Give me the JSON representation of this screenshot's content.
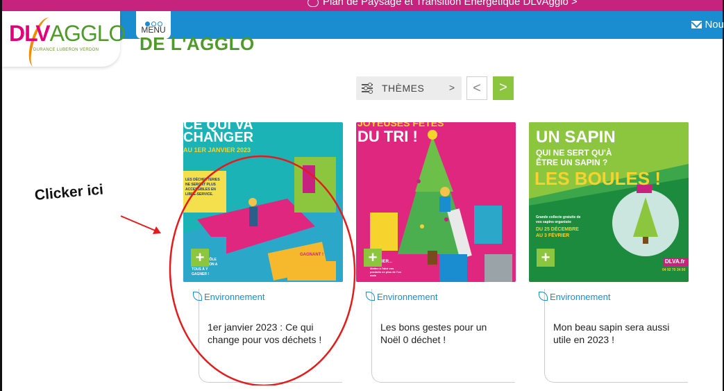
{
  "topbar": {
    "promo_text": "Plan de Paysage et Transition Energétique DLVAgglo >"
  },
  "header": {
    "logo": {
      "name": "DLVAGGLO",
      "dl": "DLV",
      "agglo": "AGGLO",
      "subtitle": "DURANCE LUBERON VERDON"
    },
    "menu_label": "MENU",
    "newsletter_label": "Nou",
    "section_title": "DE L'AGGLO"
  },
  "filters": {
    "themes_label": "THÈMES",
    "themes_chevron": ">",
    "prev": "<",
    "next": ">"
  },
  "cards": [
    {
      "tag": "Environnement",
      "title": "1er janvier 2023 : Ce qui change pour vos déchets !",
      "plus": "+",
      "art": {
        "headline1": "CE QUI VA",
        "headline2": "CHANGER",
        "headline3": "AU 1ER JANVIER 2023",
        "note1": "LES DÉCHETTERIES NE SERONT PLUS ACCESSIBLES EN LIBRE-SERVICE.",
        "note2": "LE CONTRÔLE D'ACCÈS, ON A TOUS À Y GAGNER !",
        "ticket": "GAGNANT !"
      },
      "bg": "#1bb3b5"
    },
    {
      "tag": "Environnement",
      "title": "Les bons gestes pour un Noël 0 déchet !",
      "plus": "+",
      "art": {
        "headline1": "JOYEUSES FÊTES",
        "headline2": "DU TRI !",
        "note1": "...XTRIER...",
        "note2": "Mettez à l'abri vos produits en plus de l'un mais"
      },
      "bg": "#e0277f"
    },
    {
      "tag": "Environnement",
      "title": "Mon beau sapin sera aussi utile en 2023 !",
      "plus": "+",
      "art": {
        "headline1": "UN SAPIN",
        "headline2": "QUI NE SERT QU'À",
        "headline3": "ÊTRE UN SAPIN ?",
        "headline4": "LES BOULES !",
        "note1": "Grande collecte gratuite de vos sapins organisée",
        "note2": "DU 25 DÉCEMBRE AU 3 FÉVRIER",
        "brand": "DLVA.fr",
        "phone": "04 92 70 34 00"
      },
      "bg": "#3ba64a"
    }
  ],
  "annotation": {
    "text": "Clicker ici"
  },
  "colors": {
    "magenta": "#c6237f",
    "nav_blue": "#1a8dd0",
    "green": "#8cc63f",
    "annotation_red": "#e31b1b"
  }
}
